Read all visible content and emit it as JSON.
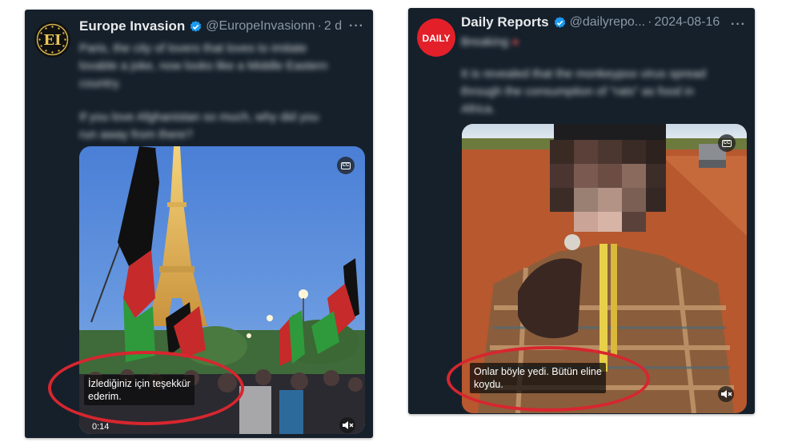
{
  "colors": {
    "card_bg": "#15202b",
    "primary_text": "#e7e9ea",
    "secondary_text": "#8b98a5",
    "verified": "#1d9bf0",
    "highlight_ring": "#d7262f"
  },
  "tweets": [
    {
      "avatar_icon": "europe-invasion-logo",
      "avatar_text": "EI",
      "display_name": "Europe Invasion",
      "handle": "@EuropeInvasionn",
      "time": "2 d",
      "more_label": "···",
      "body_blurred": [
        "Paris, the city of lovers that loves to imitate",
        "lovable a joke, now looks like a Middle Eastern",
        "country.",
        "",
        "If you love Afghanistan so much, why did you",
        "run away from there?"
      ],
      "video": {
        "description": "afghan-flags-eiffel-tower",
        "cc_label": "CC",
        "caption_lines": [
          "İzlediğiniz için teşekkür",
          "ederim."
        ],
        "timer": "0:14",
        "mute_icon": "muted-speaker-icon"
      }
    },
    {
      "avatar_icon": "daily-reports-logo",
      "avatar_text": "DAILY",
      "display_name": "Daily Reports",
      "handle": "@dailyrepo...",
      "time": "2024-08-16",
      "more_label": "···",
      "body_blurred": [
        "Breaking",
        "",
        "It is revealed that the monkeypox virus spread",
        "through the consumption of \"rats\" as food in",
        "Africa."
      ],
      "video": {
        "description": "person-eating-red-dirt-road",
        "cc_label": "CC",
        "caption_lines": [
          "Onlar böyle yedi. Bütün eline",
          "koydu."
        ],
        "mute_icon": "muted-speaker-icon"
      }
    }
  ]
}
